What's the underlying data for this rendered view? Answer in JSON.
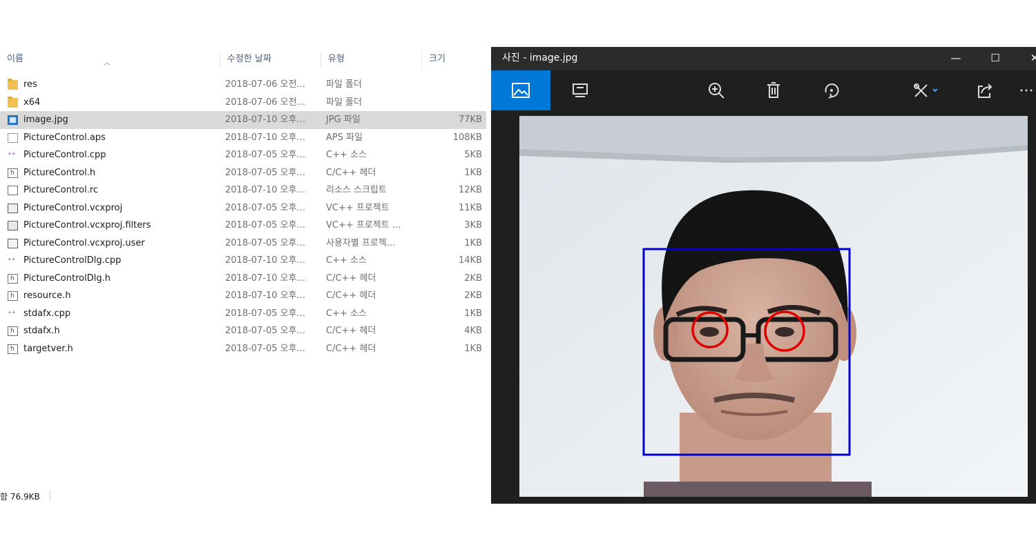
{
  "explorer": {
    "columns": {
      "name": "이름",
      "date": "수정한 날짜",
      "type": "유형",
      "size": "크기"
    },
    "files": [
      {
        "icon": "folder-icon",
        "name": "res",
        "date": "2018-07-06 오전...",
        "type": "파일 폴더",
        "size": ""
      },
      {
        "icon": "folder-icon",
        "name": "x64",
        "date": "2018-07-06 오전...",
        "type": "파일 폴더",
        "size": ""
      },
      {
        "icon": "image-file-icon",
        "name": "image.jpg",
        "date": "2018-07-10 오후...",
        "type": "JPG 파일",
        "size": "77KB",
        "selected": true
      },
      {
        "icon": "blank-file-icon",
        "name": "PictureControl.aps",
        "date": "2018-07-10 오후...",
        "type": "APS 파일",
        "size": "108KB"
      },
      {
        "icon": "cpp-file-icon",
        "name": "PictureControl.cpp",
        "date": "2018-07-05 오후...",
        "type": "C++ 소스",
        "size": "5KB"
      },
      {
        "icon": "header-file-icon",
        "name": "PictureControl.h",
        "date": "2018-07-05 오후...",
        "type": "C/C++ 헤더",
        "size": "1KB"
      },
      {
        "icon": "resource-script-icon",
        "name": "PictureControl.rc",
        "date": "2018-07-10 오후...",
        "type": "리소스 스크립트",
        "size": "12KB"
      },
      {
        "icon": "vc-project-icon",
        "name": "PictureControl.vcxproj",
        "date": "2018-07-05 오후...",
        "type": "VC++ 프로젝트",
        "size": "11KB"
      },
      {
        "icon": "filters-file-icon",
        "name": "PictureControl.vcxproj.filters",
        "date": "2018-07-05 오후...",
        "type": "VC++ 프로젝트 ...",
        "size": "3KB"
      },
      {
        "icon": "user-project-icon",
        "name": "PictureControl.vcxproj.user",
        "date": "2018-07-05 오후...",
        "type": "사용자별 프로젝...",
        "size": "1KB"
      },
      {
        "icon": "cpp-file-icon",
        "name": "PictureControlDlg.cpp",
        "date": "2018-07-10 오후...",
        "type": "C++ 소스",
        "size": "14KB"
      },
      {
        "icon": "header-file-icon",
        "name": "PictureControlDlg.h",
        "date": "2018-07-10 오후...",
        "type": "C/C++ 헤더",
        "size": "2KB"
      },
      {
        "icon": "header-file-icon",
        "name": "resource.h",
        "date": "2018-07-10 오후...",
        "type": "C/C++ 헤더",
        "size": "2KB"
      },
      {
        "icon": "cpp-file-icon",
        "name": "stdafx.cpp",
        "date": "2018-07-05 오후...",
        "type": "C++ 소스",
        "size": "1KB"
      },
      {
        "icon": "header-file-icon",
        "name": "stdafx.h",
        "date": "2018-07-05 오후...",
        "type": "C/C++ 헤더",
        "size": "4KB"
      },
      {
        "icon": "header-file-icon",
        "name": "targetver.h",
        "date": "2018-07-05 오후...",
        "type": "C/C++ 헤더",
        "size": "1KB"
      }
    ],
    "status": "함 76.9KB"
  },
  "photos": {
    "title": "사진 - image.jpg",
    "window_buttons": {
      "minimize": "—",
      "maximize": "☐",
      "close": "✕"
    },
    "toolbar": [
      "image-view-icon",
      "slideshow-icon",
      "zoom-in-icon",
      "delete-icon",
      "rotate-icon",
      "edit-draw-icon",
      "share-icon",
      "more-icon"
    ],
    "accent_color": "#0078d7",
    "detection_box_color": "#0000cc",
    "eye_circle_color": "#e00000"
  }
}
